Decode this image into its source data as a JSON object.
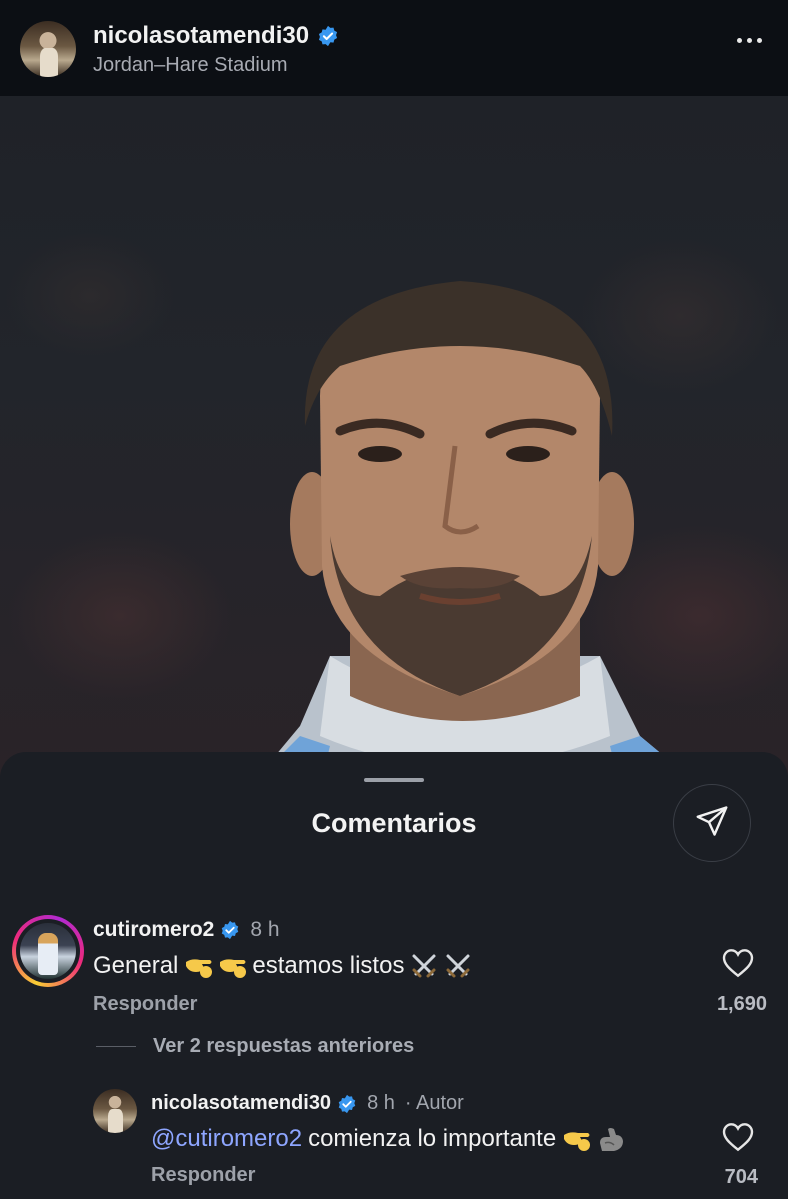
{
  "header": {
    "username": "nicolasotamendi30",
    "location": "Jordan–Hare Stadium",
    "avatar_icon": "profile-photo",
    "verified_icon": "verified-badge-icon",
    "more_icon": "more-options-icon"
  },
  "photo": {
    "subject_icon": "player-portrait"
  },
  "comments_sheet": {
    "title": "Comentarios",
    "share_icon": "paper-plane-icon",
    "comment": {
      "username": "cutiromero2",
      "time": "8 h",
      "text_before": "General",
      "text_after": "estamos listos",
      "emoji_1": "saluting-hand-icon",
      "emoji_2": "crossed-swords-icon",
      "reply_label": "Responder",
      "like_count": "1,690"
    },
    "view_replies_label": "Ver 2 respuestas anteriores",
    "reply": {
      "username": "nicolasotamendi30",
      "time": "8 h",
      "author_tag": "· Autor",
      "mention": "@cutiromero2",
      "text": "comienza lo importante",
      "emoji_1": "saluting-hand-icon",
      "emoji_2": "flexed-biceps-icon",
      "reply_label": "Responder",
      "like_count": "704"
    }
  },
  "colors": {
    "background": "#0c0f14",
    "sheet": "#1b1e24",
    "verified_blue": "#3897f0",
    "mention_blue": "#8ea6ff",
    "muted_text": "#9da1a9"
  }
}
